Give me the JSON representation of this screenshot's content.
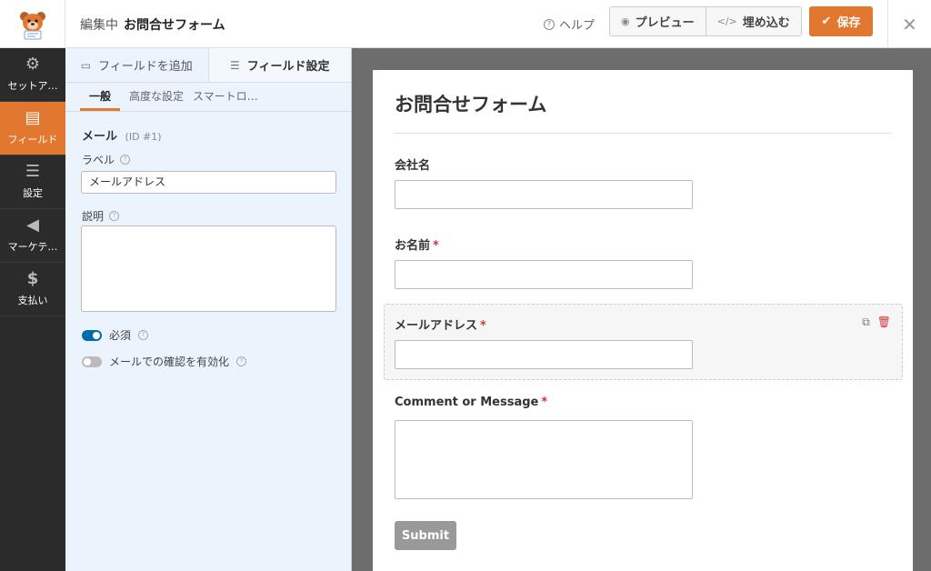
{
  "header": {
    "editing_prefix": "編集中",
    "form_name": "お問合せフォーム",
    "help_label": "ヘルプ",
    "preview_label": "プレビュー",
    "embed_label": "埋め込む",
    "save_label": "保存"
  },
  "sidebar": {
    "items": [
      {
        "label": "セットア…",
        "icon": "gear-icon"
      },
      {
        "label": "フィールド",
        "icon": "fields-icon"
      },
      {
        "label": "設定",
        "icon": "sliders-icon"
      },
      {
        "label": "マーケテ…",
        "icon": "megaphone-icon"
      },
      {
        "label": "支払い",
        "icon": "dollar-icon"
      }
    ],
    "active_index": 1
  },
  "panel": {
    "tabs": [
      "フィールドを追加",
      "フィールド設定"
    ],
    "subtabs": [
      "一般",
      "高度な設定",
      "スマートロ…"
    ],
    "field_type": "メール",
    "field_id": "(ID #1)",
    "label_caption": "ラベル",
    "label_value": "メールアドレス",
    "description_caption": "説明",
    "required_label": "必須",
    "confirm_label": "メールでの確認を有効化"
  },
  "form": {
    "title": "お問合せフォーム",
    "fields": [
      {
        "label": "会社名",
        "required": false
      },
      {
        "label": "お名前",
        "required": true
      },
      {
        "label": "メールアドレス",
        "required": true
      },
      {
        "label": "Comment or Message",
        "required": true
      }
    ],
    "required_mark": "*",
    "submit_label": "Submit"
  },
  "colors": {
    "accent": "#e27730",
    "toggle_on": "#036aab",
    "required": "#d63638"
  }
}
